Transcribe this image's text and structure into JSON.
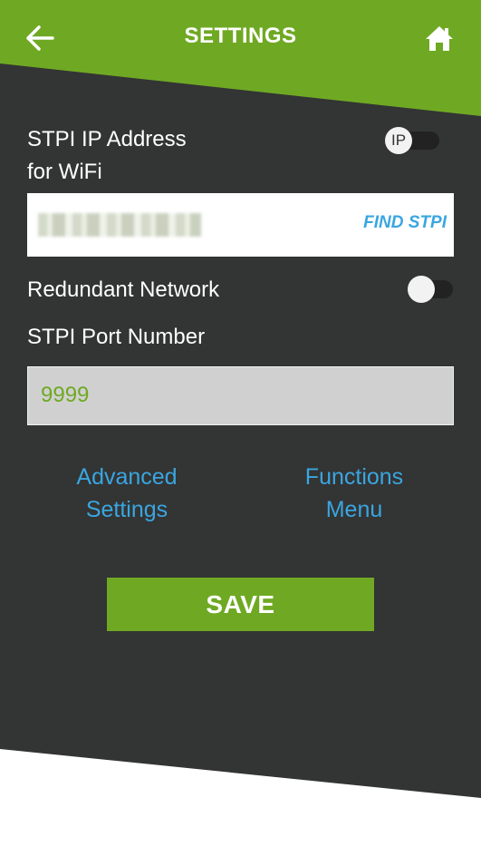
{
  "header": {
    "title": "SETTINGS",
    "back_icon": "arrow-left-icon",
    "home_icon": "home-icon"
  },
  "ip_section": {
    "label_line1": "STPI IP Address",
    "label_line2": "for WiFi",
    "toggle_label": "IP",
    "find_button": "FIND STPI"
  },
  "redundant": {
    "label": "Redundant Network"
  },
  "port": {
    "label": "STPI Port Number",
    "value": "9999"
  },
  "links": {
    "advanced_line1": "Advanced",
    "advanced_line2": "Settings",
    "functions_line1": "Functions",
    "functions_line2": "Menu"
  },
  "save_label": "SAVE",
  "colors": {
    "brand_green": "#6fa923",
    "dark_bg": "#333434",
    "link_blue": "#3aa6e0"
  }
}
